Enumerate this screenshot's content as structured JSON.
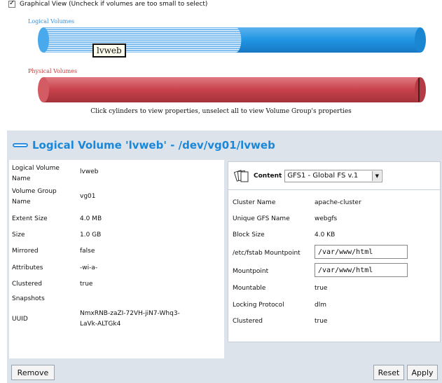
{
  "graphical_view": {
    "checked": true,
    "label": "Graphical View (Uncheck if volumes are too small to select)"
  },
  "cylinders": {
    "logical_label": "Logical Volumes",
    "physical_label": "Physical Volumes",
    "selected_fraction": 0.51,
    "hint": "Click cylinders to view properties, unselect all to view Volume Group's properties",
    "tooltip": "lvweb",
    "colors": {
      "logical_fill": "#1f95e2",
      "logical_selected_stripe": "#9bcdf0",
      "physical_fill": "#c8414b"
    }
  },
  "panel": {
    "title": "Logical Volume 'lvweb' - /dev/vg01/lvweb",
    "properties": [
      {
        "key": "Logical Volume Name",
        "value": "lvweb"
      },
      {
        "key": "Volume Group Name",
        "value": "vg01"
      },
      {
        "key": "Extent Size",
        "value": "4.0 MB"
      },
      {
        "key": "Size",
        "value": "1.0 GB"
      },
      {
        "key": "Mirrored",
        "value": "false"
      },
      {
        "key": "Attributes",
        "value": "-wi-a-"
      },
      {
        "key": "Clustered",
        "value": "true"
      },
      {
        "key": "Snapshots",
        "value": ""
      },
      {
        "key": "UUID",
        "value": "NmxRNB-zaZI-72VH-jiN7-Whq3-LaVk-ALTGk4"
      }
    ],
    "content": {
      "label": "Content",
      "selected": "GFS1 - Global FS v.1",
      "fields": {
        "cluster_name": {
          "key": "Cluster Name",
          "value": "apache-cluster"
        },
        "unique_gfs_name": {
          "key": "Unique GFS Name",
          "value": "webgfs"
        },
        "block_size": {
          "key": "Block Size",
          "value": "4.0 KB"
        },
        "fstab_mountpoint": {
          "key": "/etc/fstab Mountpoint",
          "value": "/var/www/html"
        },
        "mountpoint": {
          "key": "Mountpoint",
          "value": "/var/www/html"
        },
        "mountable": {
          "key": "Mountable",
          "value": "true"
        },
        "locking_protocol": {
          "key": "Locking Protocol",
          "value": "dlm"
        },
        "clustered": {
          "key": "Clustered",
          "value": "true"
        }
      }
    },
    "buttons": {
      "remove": "Remove",
      "reset": "Reset",
      "apply": "Apply"
    }
  }
}
